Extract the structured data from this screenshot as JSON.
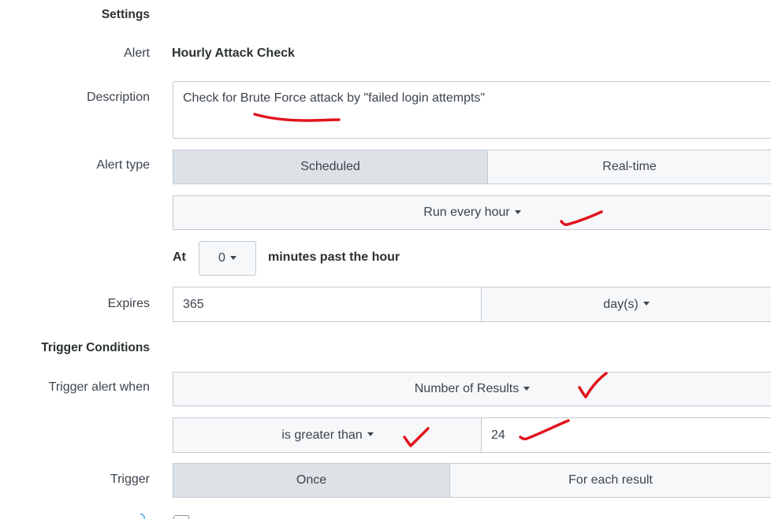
{
  "settings": {
    "heading": "Settings",
    "alert_label": "Alert",
    "alert_value": "Hourly Attack Check",
    "description_label": "Description",
    "description_value": "Check for Brute Force attack by \"failed login attempts\"",
    "alert_type_label": "Alert type",
    "alert_type_options": [
      "Scheduled",
      "Real-time"
    ],
    "alert_type_selected": "Scheduled",
    "schedule_value": "Run every hour",
    "at_label": "At",
    "minute_value": "0",
    "minutes_suffix": "minutes past the hour",
    "expires_label": "Expires",
    "expires_value": "365",
    "expires_unit": "day(s)"
  },
  "trigger_conditions": {
    "heading": "Trigger Conditions",
    "trigger_when_label": "Trigger alert when",
    "trigger_when_value": "Number of Results",
    "comparison_value": "is greater than",
    "threshold_value": "24",
    "trigger_label": "Trigger",
    "trigger_options": [
      "Once",
      "For each result"
    ],
    "trigger_selected": "Once"
  },
  "colors": {
    "annotation": "#e0141e",
    "active_segment": "#dde2e7",
    "border": "#c3cbd4"
  }
}
